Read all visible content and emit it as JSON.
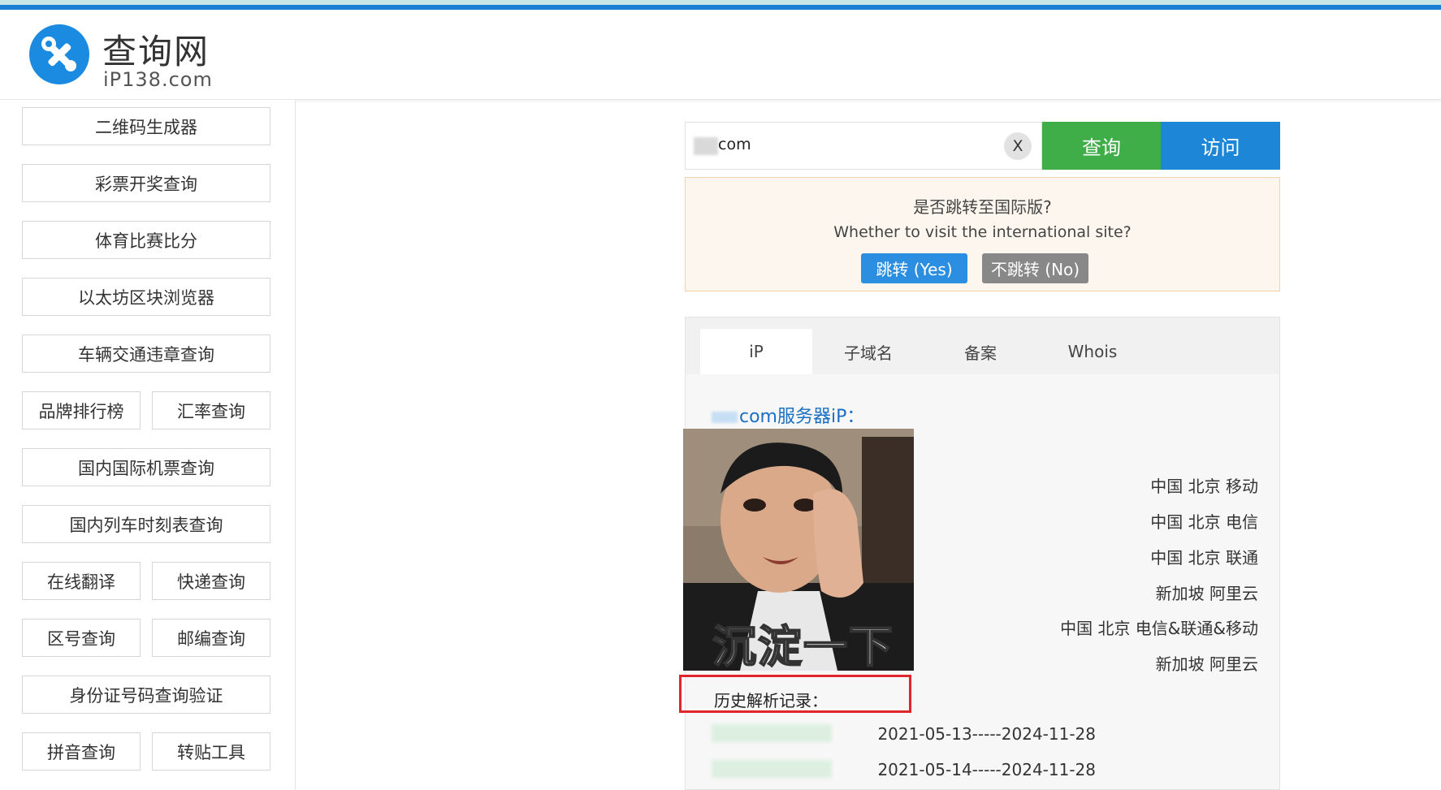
{
  "header": {
    "logo_title": "查询网",
    "logo_sub": "iP138.com"
  },
  "sidebar": {
    "items": [
      {
        "label": "二维码生成器"
      },
      {
        "label": "彩票开奖查询"
      },
      {
        "label": "体育比赛比分"
      },
      {
        "label": "以太坊区块浏览器"
      },
      {
        "label": "车辆交通违章查询"
      },
      {
        "label": "品牌排行榜"
      },
      {
        "label": "汇率查询"
      },
      {
        "label": "国内国际机票查询"
      },
      {
        "label": "国内列车时刻表查询"
      },
      {
        "label": "在线翻译"
      },
      {
        "label": "快递查询"
      },
      {
        "label": "区号查询"
      },
      {
        "label": "邮编查询"
      },
      {
        "label": "身份证号码查询验证"
      },
      {
        "label": "拼音查询"
      },
      {
        "label": "转贴工具"
      }
    ]
  },
  "search": {
    "value": "com",
    "clear_label": "X",
    "query_label": "查询",
    "visit_label": "访问"
  },
  "intl": {
    "question": "是否跳转至国际版?",
    "question_en": "Whether to visit the international site?",
    "yes_label": "跳转 (Yes)",
    "no_label": "不跳转 (No)"
  },
  "tabs": [
    {
      "label": "iP"
    },
    {
      "label": "子域名"
    },
    {
      "label": "备案"
    },
    {
      "label": "Whois"
    }
  ],
  "result": {
    "server_ip_label": "com服务器iP：",
    "ip_locations": [
      "中国 北京 移动",
      "中国 北京 电信",
      "中国 北京 联通",
      "新加坡 阿里云",
      "中国 北京 电信&联通&移动",
      "新加坡 阿里云"
    ],
    "video_caption": "沉淀一下",
    "history_label": "历史解析记录：",
    "history": [
      {
        "range": "2021-05-13-----2024-11-28"
      },
      {
        "range": "2021-05-14-----2024-11-28"
      }
    ]
  },
  "colors": {
    "query_button": "#3fae49",
    "visit_button": "#1d86d6",
    "link_blue": "#1a6fc2",
    "highlight_red": "#e0262c"
  }
}
